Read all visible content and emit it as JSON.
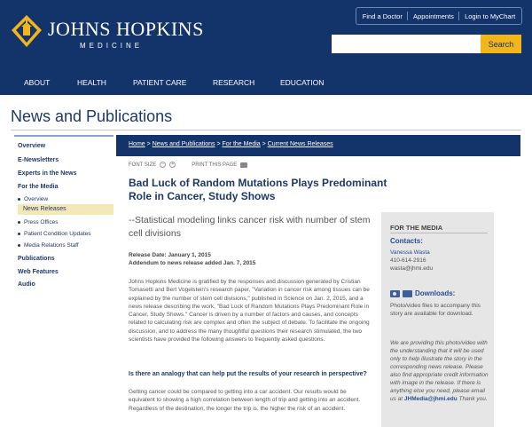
{
  "header": {
    "brand": "JOHNS HOPKINS",
    "brand_sub": "MEDICINE",
    "utility_links": [
      "Find a Doctor",
      "Appointments",
      "Login to MyChart"
    ],
    "search_placeholder": "",
    "search_button": "Search",
    "nav": [
      "ABOUT",
      "HEALTH",
      "PATIENT CARE",
      "RESEARCH",
      "EDUCATION"
    ],
    "colors": {
      "header_bg": "#13336b",
      "search_btn": "#f2b51a"
    }
  },
  "page_title": "News and Publications",
  "sidebar": {
    "items": [
      "Overview",
      "E-Newsletters",
      "Experts in the News",
      "For the Media"
    ],
    "sub_items": [
      "Overview",
      "News Releases",
      "Press Offices",
      "Patient Condition Updates",
      "Media Relations Staff"
    ],
    "bottom_items": [
      "Publications",
      "Web Features",
      "Audio"
    ],
    "active": "News Releases"
  },
  "breadcrumb": {
    "parts": [
      "Home",
      "News and Publications",
      "For the Media",
      "Current News Releases"
    ],
    "separator": ">"
  },
  "tools": {
    "font_size": "FONT SIZE",
    "minus": "−",
    "plus": "+",
    "print": "PRINT THIS PAGE"
  },
  "article": {
    "headline": "Bad Luck of Random Mutations Plays Predominant Role in Cancer, Study Shows",
    "subhead": "--Statistical modeling links cancer risk with number of stem cell divisions",
    "release_date": "Release Date: January 1, 2015",
    "addendum": "Addendum to news release added Jan. 7, 2015",
    "body": "Johns Hopkins Medicine is gratified by the responses and discussion generated by Cristian Tomasetti and Bert Vogelstein's research paper, \"Variation in cancer risk among tissues can be explained by the number of stem cell divisions,\" published in Science on Jan. 2, 2015, and a news release describing the work, \"Bad Luck of Random Mutations Plays Predominant Role in Cancer, Study Shows.\" Cancer is driven by a number of factors and causes, and concepts related to calculating risk are complex and often the subject of debate. To facilitate the ongoing discussion, and to address the many thoughtful questions their research stimulated, the two scientists have provided the following answers to frequently asked questions.",
    "question": "Is there an analogy that can help put the results of your research in perspective?",
    "answer": "Getting cancer could be compared to getting into a car accident. Our results would be equivalent to showing a high correlation between length of trip and getting into an accident. Regardless of the destination, the longer the trip is, the higher the risk of an accident."
  },
  "media_panel": {
    "title": "FOR THE MEDIA",
    "contacts_label": "Contacts:",
    "contact_name": "Vanessa Wasta",
    "contact_phone": "410-614-2916",
    "contact_email": "wasta@jhmi.edu",
    "downloads_label": "Downloads:",
    "downloads_text": "Photo/video files to accompany this story are available for download.",
    "note_text": "We are providing this photo/video with the understanding that it will be used only to help illustrate the story in the corresponding news release. Please also find appropriate credit information with image in the release. If there is anything else you need, please email us at",
    "note_email": "JHMedia@jhmi.edu",
    "note_end": "Thank you."
  }
}
